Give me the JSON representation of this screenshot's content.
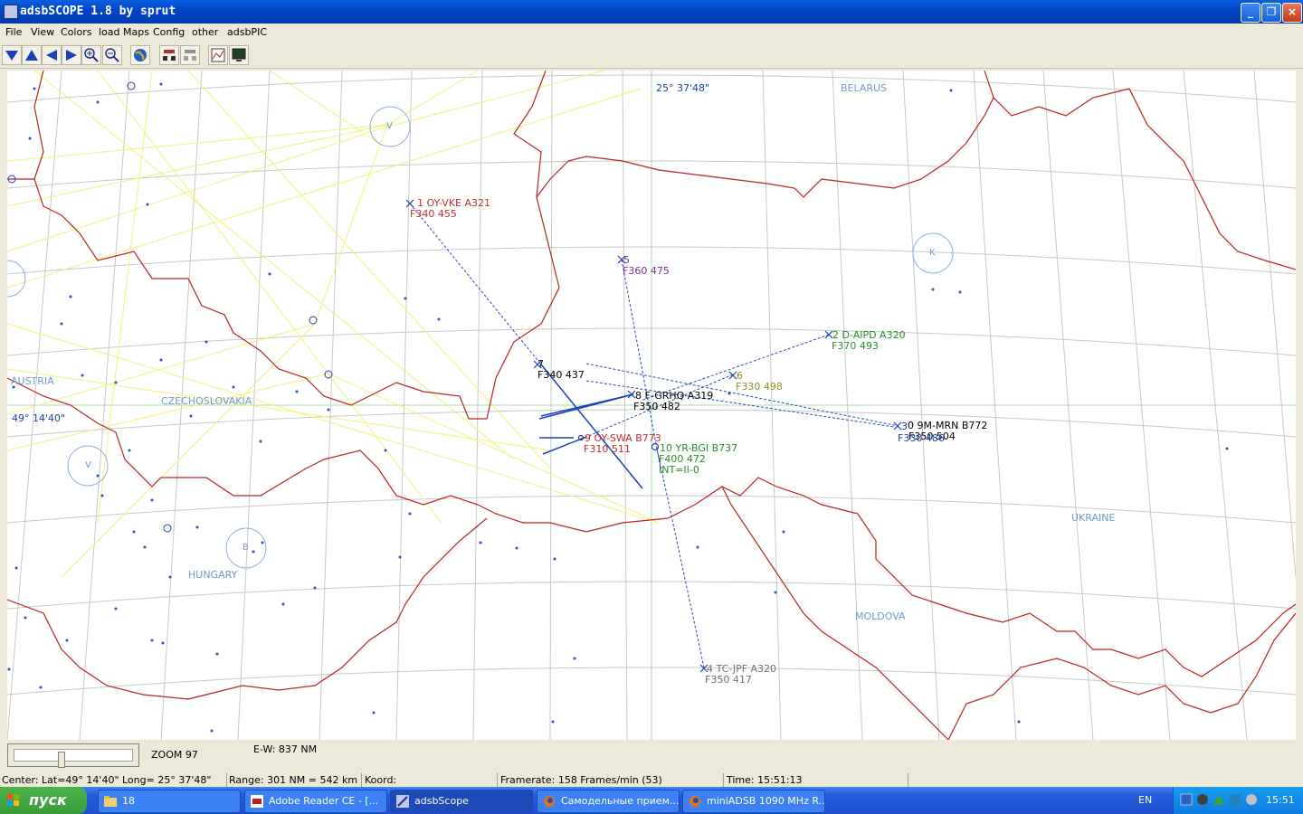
{
  "window": {
    "title": "adsbSCOPE 1.8  by sprut"
  },
  "menu": [
    "File",
    "View",
    "Colors",
    "load Maps",
    "Config",
    "other",
    "adsbPIC"
  ],
  "toolbar_icons": [
    "arrow-down-icon",
    "arrow-up-icon",
    "arrow-left-icon",
    "arrow-right-icon",
    "zoom-in-icon",
    "zoom-out-icon",
    "globe-icon",
    "group-icon",
    "group-gray-icon",
    "chart-icon",
    "monitor-icon"
  ],
  "map": {
    "countries": [
      "BELARUS",
      "AUSTRIA",
      "CZECHOSLOVAKIA",
      "HUNGARY",
      "UKRAINE",
      "MOLDOVA"
    ],
    "top_coord": "25° 37'48\"",
    "left_coord": "49° 14'40\"",
    "zones": [
      "V",
      "K",
      "V",
      "B"
    ],
    "aircraft": [
      {
        "line1": "1  OY-VKE  A321",
        "line2": "F340 455",
        "color": "red"
      },
      {
        "line1": "5",
        "line2": "F360 475",
        "color": "purple"
      },
      {
        "line1": "2  D-AIPD  A320",
        "line2": "F370 493",
        "color": "green"
      },
      {
        "line1": "7",
        "line2": "F340 437",
        "color": "black"
      },
      {
        "line1": "6",
        "line2": "F330 498",
        "color": "olive"
      },
      {
        "line1": "8  F-GRHQ  A319",
        "line2": "F350 482",
        "color": "black"
      },
      {
        "line1": "0  9M-MRN  B772",
        "line2": "F350 504",
        "color": "black"
      },
      {
        "line1": "3",
        "line2": "F330 486",
        "color": "blue"
      },
      {
        "line1": "9  OY-SWA  B773",
        "line2": "F310 511",
        "color": "red"
      },
      {
        "line1": "10  YR-BGI  B737",
        "line2": "F400 472",
        "line3": "INT=II-0",
        "color": "green"
      },
      {
        "line1": "4  TC-JPF  A320",
        "line2": "F350 417",
        "color": "gray"
      }
    ]
  },
  "bottom": {
    "zoom": "ZOOM 97",
    "ew": "E-W: 837 NM"
  },
  "status": {
    "center": "Center: Lat=49° 14'40\" Long= 25° 37'48\"",
    "range": "Range: 301 NM = 542 km",
    "koord": "Koord:",
    "framerate": "Framerate:  158 Frames/min (53)",
    "time": "Time: 15:51:13"
  },
  "taskbar": {
    "start": "пуск",
    "tasks": [
      "18",
      "Adobe Reader CE - [...",
      "adsbScope",
      "Самодельные прием...",
      "miniADSB 1090 MHz R..."
    ],
    "lang": "EN",
    "clock": "15:51"
  },
  "colors": {
    "title_bar": "#0246c8",
    "taskbar": "#245ddb",
    "border": "#c02020",
    "route": "#f0f060",
    "grid": "#c0c0c0"
  }
}
